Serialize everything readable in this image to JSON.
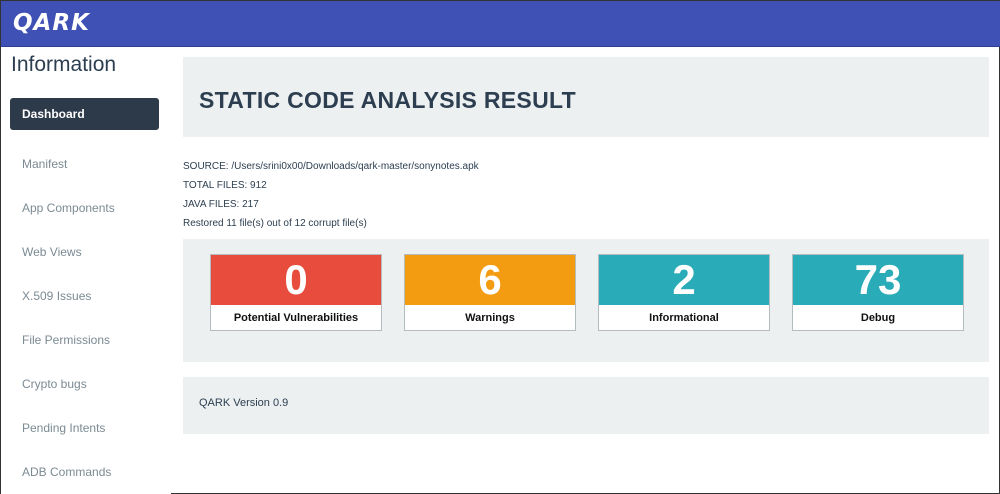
{
  "header": {
    "logo": "QARK"
  },
  "sidebar": {
    "title": "Information",
    "items": [
      {
        "label": "Dashboard",
        "active": true
      },
      {
        "label": "Manifest"
      },
      {
        "label": "App Components"
      },
      {
        "label": "Web Views"
      },
      {
        "label": "X.509 Issues"
      },
      {
        "label": "File Permissions"
      },
      {
        "label": "Crypto bugs"
      },
      {
        "label": "Pending Intents"
      },
      {
        "label": "ADB Commands"
      }
    ]
  },
  "main": {
    "title": "STATIC CODE ANALYSIS RESULT",
    "source": "SOURCE: /Users/srini0x00/Downloads/qark-master/sonynotes.apk",
    "total_files": "TOTAL FILES: 912",
    "java_files": "JAVA FILES: 217",
    "restored": "Restored 11 file(s) out of 12 corrupt file(s)",
    "stats": [
      {
        "value": "0",
        "label": "Potential Vulnerabilities",
        "color": "#e74c3c"
      },
      {
        "value": "6",
        "label": "Warnings",
        "color": "#f39c12"
      },
      {
        "value": "2",
        "label": "Informational",
        "color": "#2aabb8"
      },
      {
        "value": "73",
        "label": "Debug",
        "color": "#2aabb8"
      }
    ],
    "version": "QARK Version 0.9"
  }
}
